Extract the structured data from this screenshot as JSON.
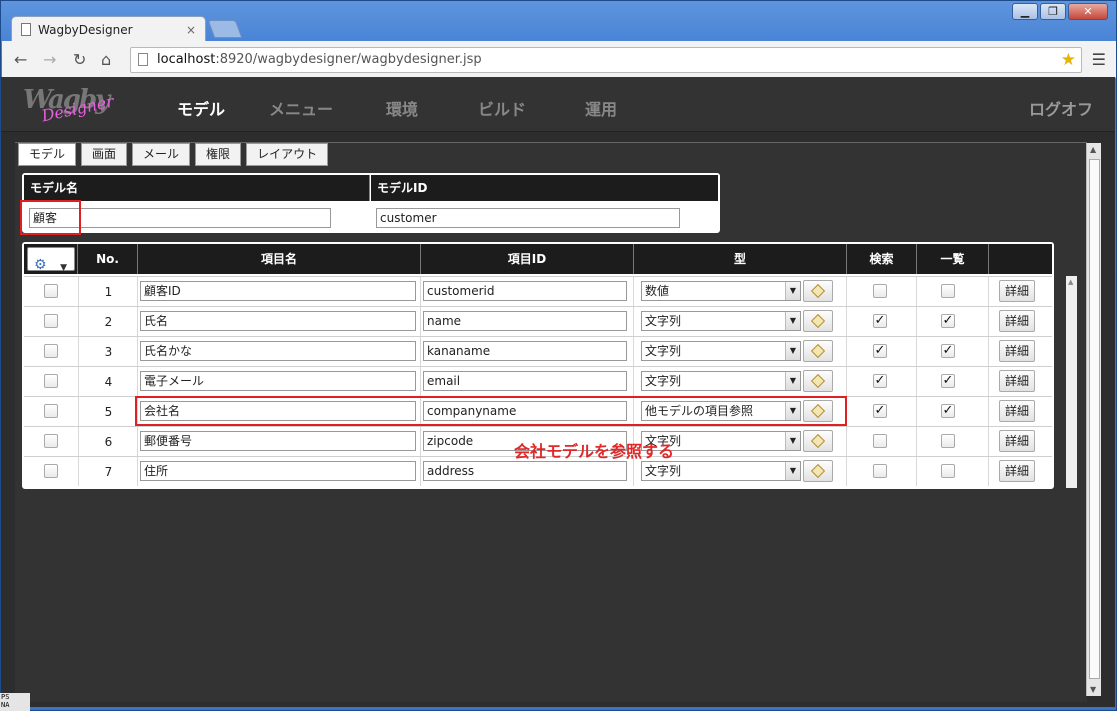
{
  "browser": {
    "tab_title": "WagbyDesigner",
    "tab_close": "×",
    "url_host": "localhost",
    "url_rest": ":8920/wagbydesigner/wagbydesigner.jsp",
    "window_buttons": [
      "▁",
      "❐",
      "✕"
    ]
  },
  "app": {
    "logo_main": "Wagby",
    "logo_sub": "Designer",
    "nav": [
      "モデル",
      "メニュー",
      "環境",
      "ビルド",
      "運用"
    ],
    "active_nav": "モデル",
    "logoff": "ログオフ"
  },
  "subtabs": [
    "モデル",
    "画面",
    "メール",
    "権限",
    "レイアウト"
  ],
  "model": {
    "name_header": "モデル名",
    "id_header": "モデルID",
    "name_value": "顧客",
    "id_value": "customer"
  },
  "items": {
    "headers": [
      "No.",
      "項目名",
      "項目ID",
      "型",
      "検索",
      "一覧"
    ],
    "detail_label": "詳細",
    "rows": [
      {
        "no": "1",
        "name": "顧客ID",
        "id": "customerid",
        "type": "数値",
        "search": false,
        "list": false
      },
      {
        "no": "2",
        "name": "氏名",
        "id": "name",
        "type": "文字列",
        "search": true,
        "list": true
      },
      {
        "no": "3",
        "name": "氏名かな",
        "id": "kananame",
        "type": "文字列",
        "search": true,
        "list": true
      },
      {
        "no": "4",
        "name": "電子メール",
        "id": "email",
        "type": "文字列",
        "search": true,
        "list": true
      },
      {
        "no": "5",
        "name": "会社名",
        "id": "companyname",
        "type": "他モデルの項目参照",
        "search": true,
        "list": true
      },
      {
        "no": "6",
        "name": "郵便番号",
        "id": "zipcode",
        "type": "文字列",
        "search": false,
        "list": false
      },
      {
        "no": "7",
        "name": "住所",
        "id": "address",
        "type": "文字列",
        "search": false,
        "list": false
      }
    ]
  },
  "annotation": "会社モデルを参照する",
  "status_text": [
    "PS",
    "NA"
  ],
  "colors": {
    "highlight": "#e02020",
    "header_bg": "#1c1c1c",
    "app_bg": "#2d2d2d"
  }
}
